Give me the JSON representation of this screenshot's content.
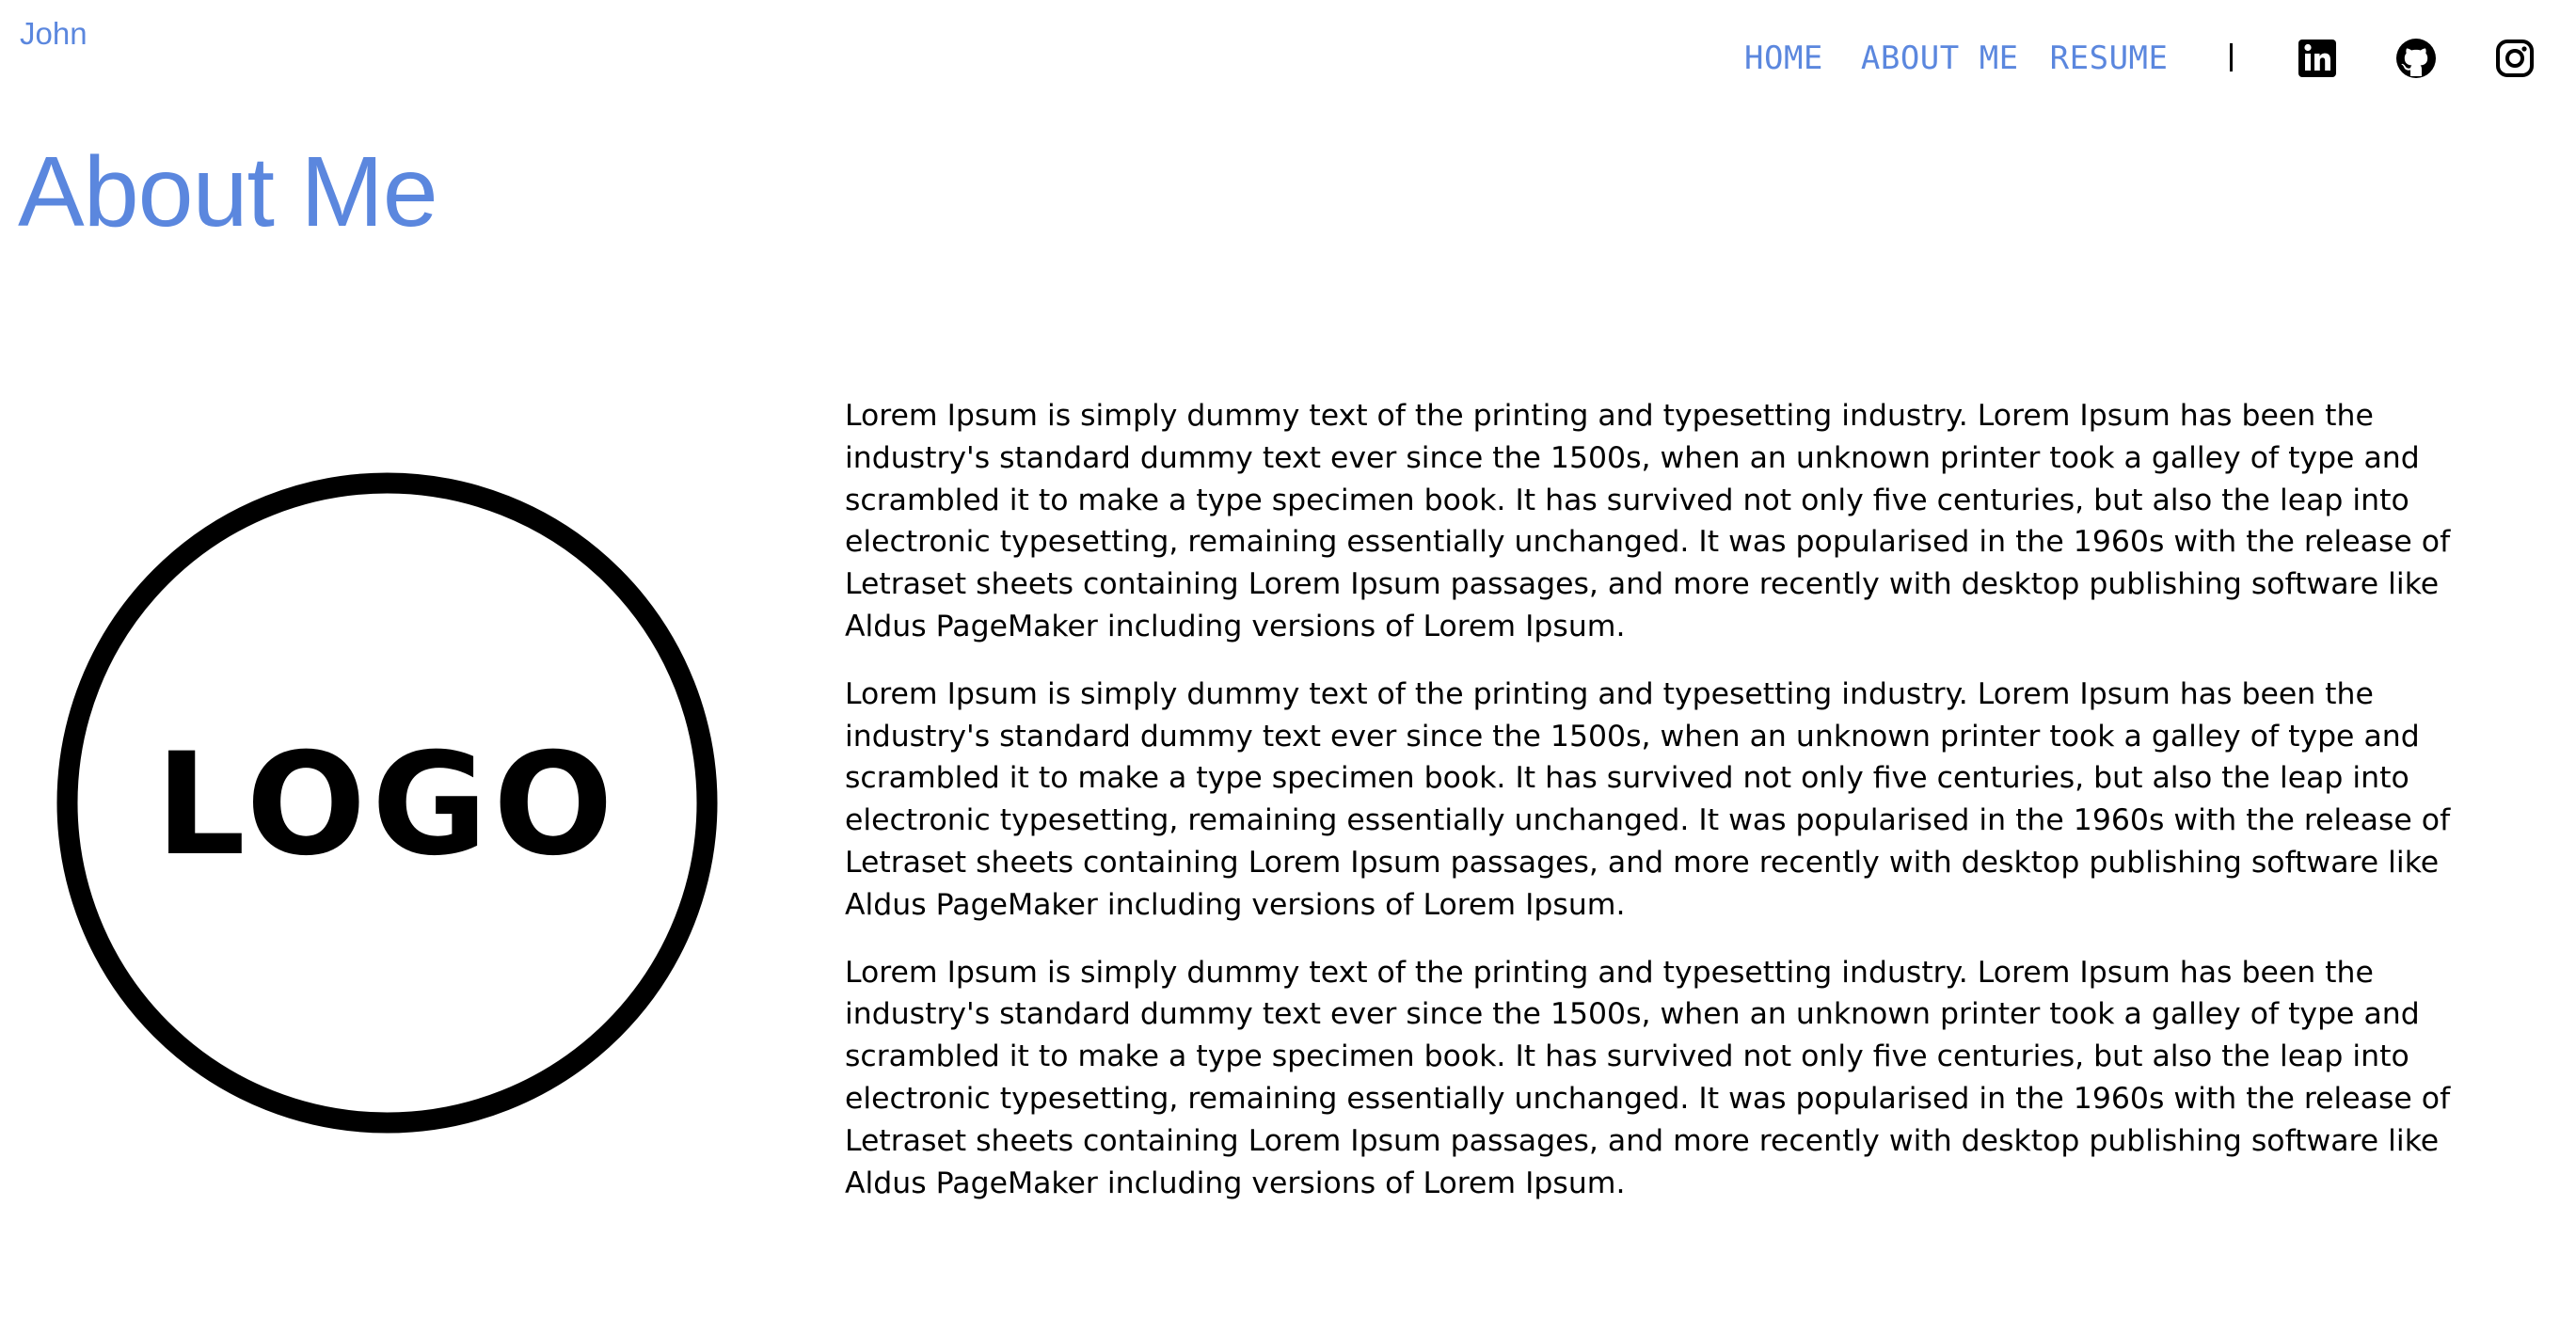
{
  "header": {
    "brand": "John",
    "nav": [
      {
        "label": "HOME"
      },
      {
        "label": "ABOUT ME"
      },
      {
        "label": "RESUME"
      }
    ],
    "separator": "|",
    "social": [
      {
        "icon": "linkedin-icon"
      },
      {
        "icon": "github-icon"
      },
      {
        "icon": "instagram-icon"
      }
    ]
  },
  "page": {
    "title": "About Me"
  },
  "logo": {
    "text": "LOGO"
  },
  "content": {
    "paragraphs": [
      "Lorem Ipsum is simply dummy text of the printing and typesetting industry. Lorem Ipsum has been the industry's standard dummy text ever since the 1500s, when an unknown printer took a galley of type and scrambled it to make a type specimen book. It has survived not only five centuries, but also the leap into electronic typesetting, remaining essentially unchanged. It was popularised in the 1960s with the release of Letraset sheets containing Lorem Ipsum passages, and more recently with desktop publishing software like Aldus PageMaker including versions of Lorem Ipsum.",
      "Lorem Ipsum is simply dummy text of the printing and typesetting industry. Lorem Ipsum has been the industry's standard dummy text ever since the 1500s, when an unknown printer took a galley of type and scrambled it to make a type specimen book. It has survived not only five centuries, but also the leap into electronic typesetting, remaining essentially unchanged. It was popularised in the 1960s with the release of Letraset sheets containing Lorem Ipsum passages, and more recently with desktop publishing software like Aldus PageMaker including versions of Lorem Ipsum.",
      "Lorem Ipsum is simply dummy text of the printing and typesetting industry. Lorem Ipsum has been the industry's standard dummy text ever since the 1500s, when an unknown printer took a galley of type and scrambled it to make a type specimen book. It has survived not only five centuries, but also the leap into electronic typesetting, remaining essentially unchanged. It was popularised in the 1960s with the release of Letraset sheets containing Lorem Ipsum passages, and more recently with desktop publishing software like Aldus PageMaker including versions of Lorem Ipsum."
    ]
  },
  "colors": {
    "accent": "#5b87de",
    "text": "#000000",
    "background": "#ffffff"
  }
}
